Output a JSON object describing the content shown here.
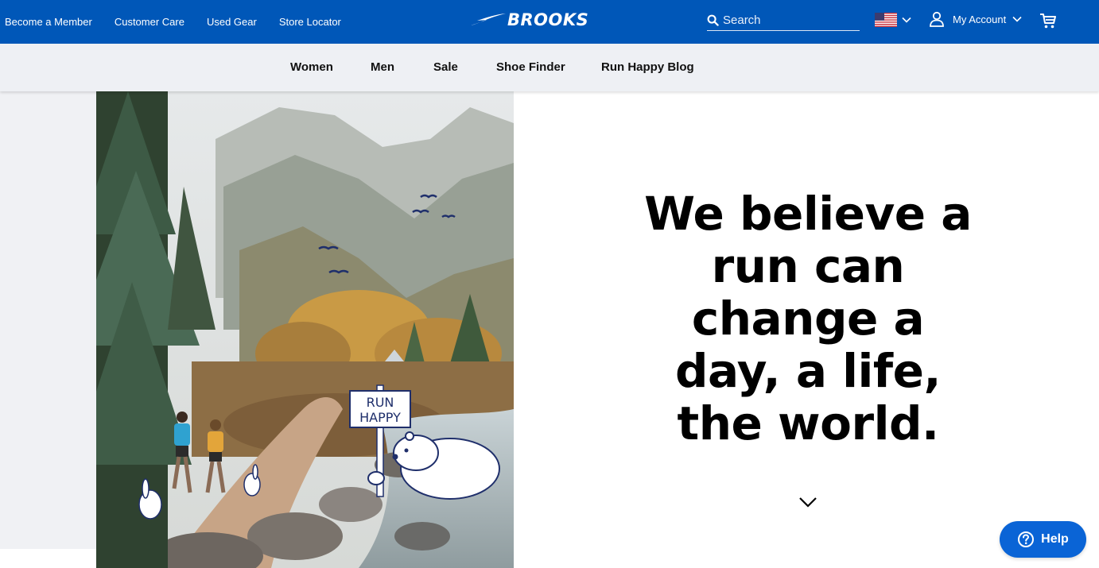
{
  "header": {
    "utility_links": [
      {
        "label": "Become a Member",
        "icon": "none"
      },
      {
        "label": "Customer Care",
        "icon": "none"
      },
      {
        "label": "Used Gear",
        "icon": "none"
      },
      {
        "label": "Store Locator",
        "icon": "none"
      }
    ],
    "logo_text": "BROOKS",
    "search": {
      "placeholder": "Search",
      "value": "",
      "icon": "search-icon"
    },
    "country": {
      "flag": "us-flag-icon"
    },
    "account_label": "My Account",
    "cart_icon": "cart-icon",
    "brand_color": "#0057b8"
  },
  "nav": {
    "items": [
      {
        "label": "Women"
      },
      {
        "label": "Men"
      },
      {
        "label": "Sale"
      },
      {
        "label": "Shoe Finder"
      },
      {
        "label": "Run Happy Blog"
      }
    ]
  },
  "hero": {
    "sign_text_line1": "RUN",
    "sign_text_line2": "HAPPY",
    "headline_lines": [
      "We believe a",
      "run can",
      "change a",
      "day, a life,",
      "the world."
    ],
    "scroll_icon": "chevron-down-icon"
  },
  "help": {
    "label": "Help",
    "icon": "question-circle-icon",
    "color": "#0a64d6"
  }
}
